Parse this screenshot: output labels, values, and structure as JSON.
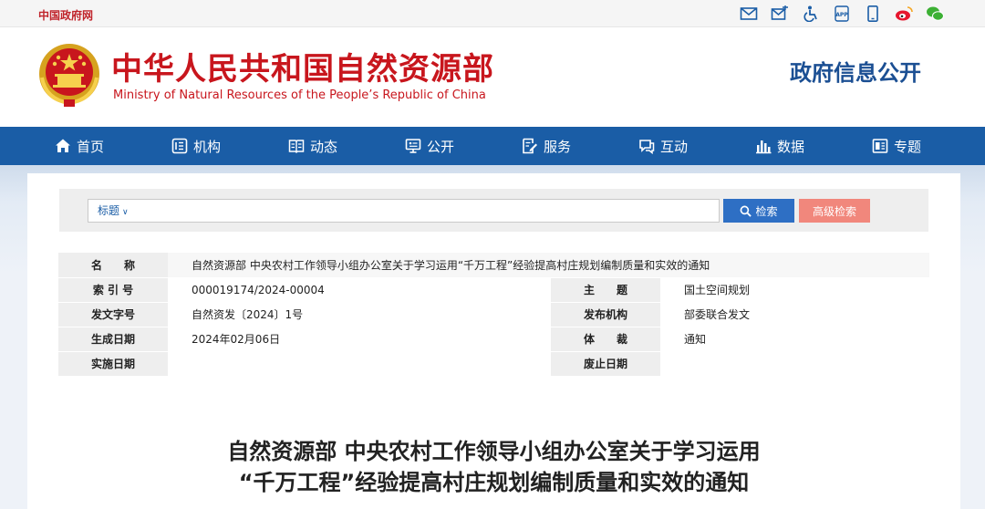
{
  "topbar": {
    "gov_link": "中国政府网",
    "icons": [
      "mail-icon",
      "letter-icon",
      "accessibility-icon",
      "app-icon",
      "mobile-icon",
      "weibo-icon",
      "wechat-icon"
    ],
    "app_label": "APP"
  },
  "header": {
    "org_cn": "中华人民共和国自然资源部",
    "org_en": "Ministry of Natural Resources of the People’s Republic of China",
    "right_title": "政府信息公开"
  },
  "nav": {
    "items": [
      {
        "label": "首页",
        "icon": "home-icon"
      },
      {
        "label": "机构",
        "icon": "org-icon"
      },
      {
        "label": "动态",
        "icon": "book-icon"
      },
      {
        "label": "公开",
        "icon": "monitor-icon"
      },
      {
        "label": "服务",
        "icon": "document-edit-icon"
      },
      {
        "label": "互动",
        "icon": "chat-icon"
      },
      {
        "label": "数据",
        "icon": "bar-chart-icon"
      },
      {
        "label": "专题",
        "icon": "topic-icon"
      }
    ]
  },
  "search": {
    "type_label": "标题",
    "placeholder": "",
    "search_button": "检索",
    "advanced_button": "高级检索"
  },
  "info": {
    "name_label": "名　　称",
    "name_value": "自然资源部 中央农村工作领导小组办公室关于学习运用“千万工程”经验提高村庄规划编制质量和实效的通知",
    "index_label": "索 引 号",
    "index_value": "000019174/2024-00004",
    "topic_label": "主　　题",
    "topic_value": "国土空间规划",
    "doc_no_label": "发文字号",
    "doc_no_value": "自然资发〔2024〕1号",
    "issuer_label": "发布机构",
    "issuer_value": "部委联合发文",
    "date_label": "生成日期",
    "date_value": "2024年02月06日",
    "genre_label": "体　　裁",
    "genre_value": "通知",
    "effective_label": "实施日期",
    "effective_value": "",
    "expire_label": "废止日期",
    "expire_value": ""
  },
  "document": {
    "title_line1": "自然资源部 中央农村工作领导小组办公室关于学习运用",
    "title_line2": "“千万工程”经验提高村庄规划编制质量和实效的通知"
  },
  "colors": {
    "brand_red": "#c8161d",
    "nav_blue": "#1a5da6",
    "search_blue": "#2e6fc4",
    "advanced_pink": "#f1877c"
  }
}
